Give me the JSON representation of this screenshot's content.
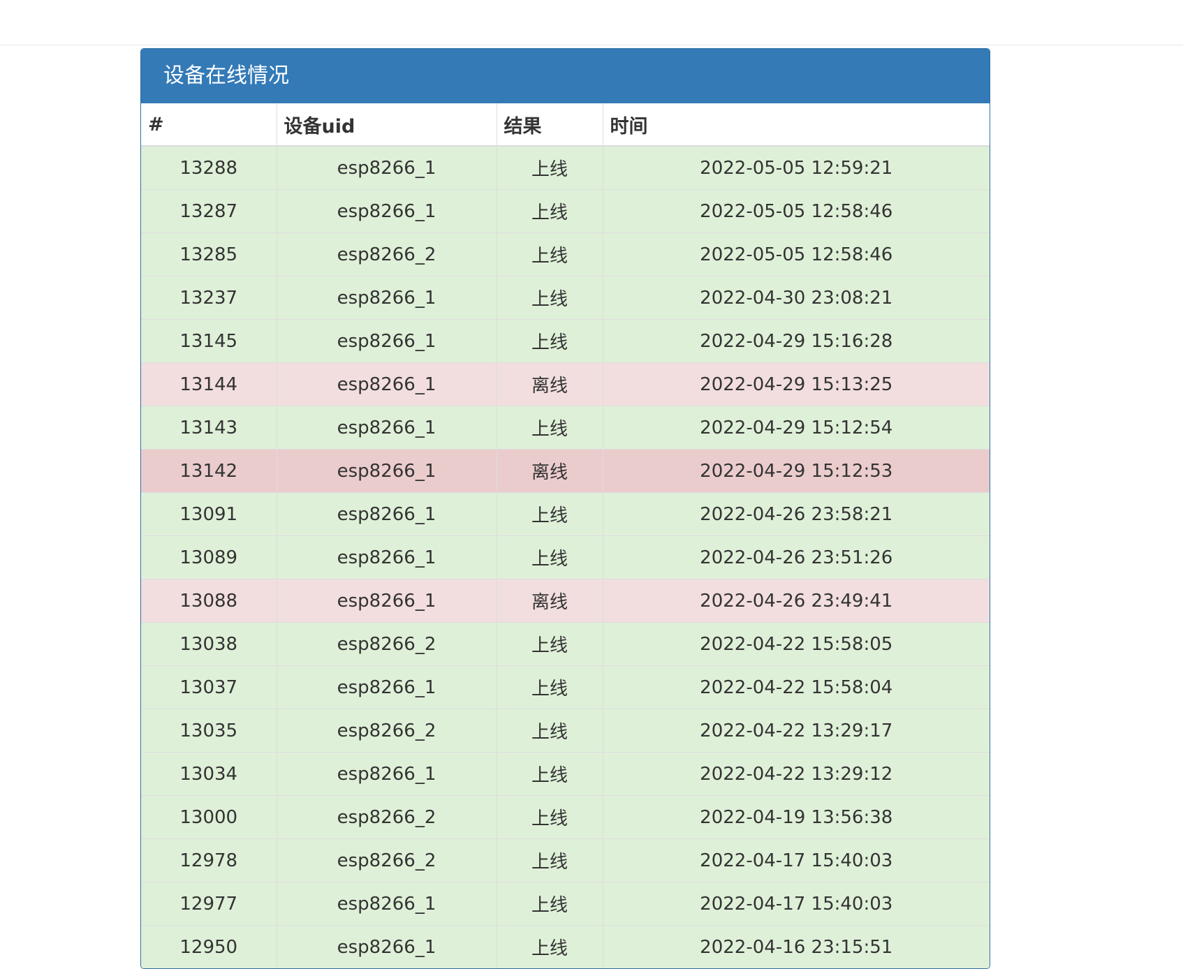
{
  "panel": {
    "title": "设备在线情况"
  },
  "table": {
    "headers": [
      "#",
      "设备uid",
      "结果",
      "时间"
    ],
    "rows": [
      {
        "id": "13288",
        "uid": "esp8266_1",
        "result": "上线",
        "time": "2022-05-05 12:59:21",
        "status": "success"
      },
      {
        "id": "13287",
        "uid": "esp8266_1",
        "result": "上线",
        "time": "2022-05-05 12:58:46",
        "status": "success"
      },
      {
        "id": "13285",
        "uid": "esp8266_2",
        "result": "上线",
        "time": "2022-05-05 12:58:46",
        "status": "success"
      },
      {
        "id": "13237",
        "uid": "esp8266_1",
        "result": "上线",
        "time": "2022-04-30 23:08:21",
        "status": "success"
      },
      {
        "id": "13145",
        "uid": "esp8266_1",
        "result": "上线",
        "time": "2022-04-29 15:16:28",
        "status": "success"
      },
      {
        "id": "13144",
        "uid": "esp8266_1",
        "result": "离线",
        "time": "2022-04-29 15:13:25",
        "status": "danger"
      },
      {
        "id": "13143",
        "uid": "esp8266_1",
        "result": "上线",
        "time": "2022-04-29 15:12:54",
        "status": "success"
      },
      {
        "id": "13142",
        "uid": "esp8266_1",
        "result": "离线",
        "time": "2022-04-29 15:12:53",
        "status": "danger-hover"
      },
      {
        "id": "13091",
        "uid": "esp8266_1",
        "result": "上线",
        "time": "2022-04-26 23:58:21",
        "status": "success"
      },
      {
        "id": "13089",
        "uid": "esp8266_1",
        "result": "上线",
        "time": "2022-04-26 23:51:26",
        "status": "success"
      },
      {
        "id": "13088",
        "uid": "esp8266_1",
        "result": "离线",
        "time": "2022-04-26 23:49:41",
        "status": "danger"
      },
      {
        "id": "13038",
        "uid": "esp8266_2",
        "result": "上线",
        "time": "2022-04-22 15:58:05",
        "status": "success"
      },
      {
        "id": "13037",
        "uid": "esp8266_1",
        "result": "上线",
        "time": "2022-04-22 15:58:04",
        "status": "success"
      },
      {
        "id": "13035",
        "uid": "esp8266_2",
        "result": "上线",
        "time": "2022-04-22 13:29:17",
        "status": "success"
      },
      {
        "id": "13034",
        "uid": "esp8266_1",
        "result": "上线",
        "time": "2022-04-22 13:29:12",
        "status": "success"
      },
      {
        "id": "13000",
        "uid": "esp8266_2",
        "result": "上线",
        "time": "2022-04-19 13:56:38",
        "status": "success"
      },
      {
        "id": "12978",
        "uid": "esp8266_2",
        "result": "上线",
        "time": "2022-04-17 15:40:03",
        "status": "success"
      },
      {
        "id": "12977",
        "uid": "esp8266_1",
        "result": "上线",
        "time": "2022-04-17 15:40:03",
        "status": "success"
      },
      {
        "id": "12950",
        "uid": "esp8266_1",
        "result": "上线",
        "time": "2022-04-16 23:15:51",
        "status": "success"
      }
    ]
  },
  "colors": {
    "panel_header": "#337ab7",
    "success_row": "#dff0d8",
    "danger_row": "#f2dede",
    "danger_hover_row": "#ebcccc"
  }
}
